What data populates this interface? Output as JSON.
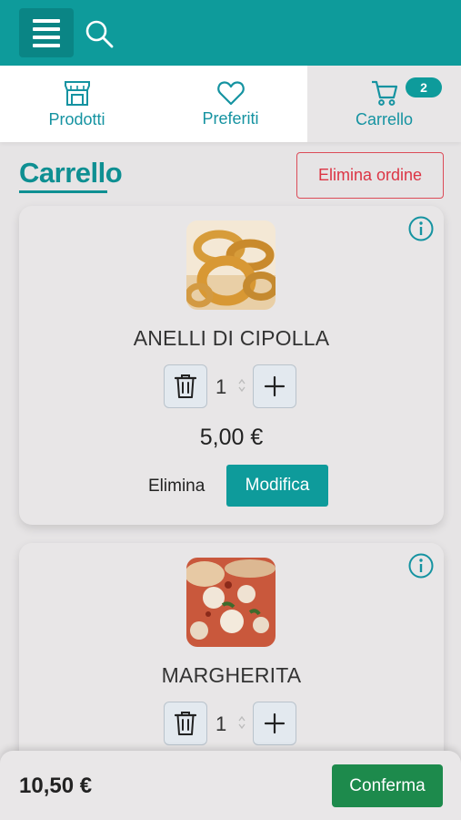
{
  "topbar": {
    "menu_icon": "hamburger-icon",
    "search_icon": "search-icon"
  },
  "tabs": [
    {
      "label": "Prodotti",
      "icon": "store-icon"
    },
    {
      "label": "Preferiti",
      "icon": "heart-icon"
    },
    {
      "label": "Carrello",
      "icon": "cart-icon",
      "badge": "2",
      "active": true
    }
  ],
  "page": {
    "title": "Carrello",
    "delete_order_label": "Elimina ordine"
  },
  "cart": {
    "items": [
      {
        "name": "ANELLI DI CIPOLLA",
        "quantity": "1",
        "price": "5,00 €",
        "remove_label": "Elimina",
        "edit_label": "Modifica",
        "image": "onion-rings-photo"
      },
      {
        "name": "MARGHERITA",
        "quantity": "1",
        "image": "pizza-photo"
      }
    ]
  },
  "footer": {
    "total": "10,50 €",
    "confirm_label": "Conferma"
  },
  "colors": {
    "primary": "#0e9b9b",
    "danger": "#dc3545",
    "success": "#1d8a4c"
  }
}
